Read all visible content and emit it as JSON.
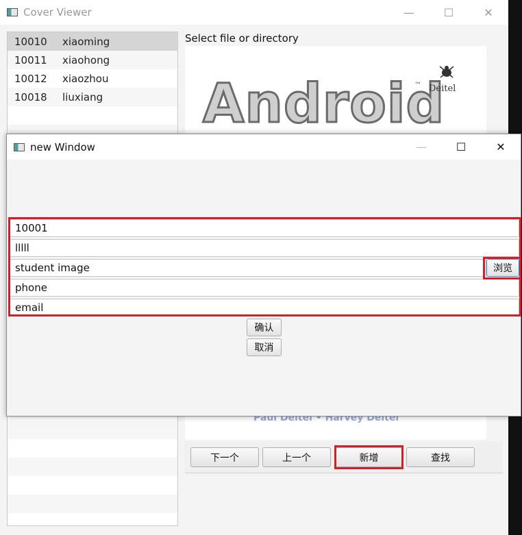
{
  "main_window": {
    "title": "Cover Viewer",
    "min_icon": "—",
    "max_icon": "☐",
    "close_icon": "✕",
    "hint": "Select file or directory",
    "students": [
      {
        "id": "10010",
        "name": "xiaoming"
      },
      {
        "id": "10011",
        "name": "xiaohong"
      },
      {
        "id": "10012",
        "name": "xiaozhou"
      },
      {
        "id": "10018",
        "name": "liuxiang"
      }
    ],
    "cover": {
      "logo_text": "Android",
      "tm": "™",
      "brand": "Deitel",
      "authors": "Paul Deitel • Harvey Deitel"
    },
    "buttons": {
      "next": "下一个",
      "prev": "上一个",
      "add": "新增",
      "find": "查找"
    }
  },
  "dialog": {
    "title": "new Window",
    "min_icon": "—",
    "max_icon": "☐",
    "close_icon": "✕",
    "fields": {
      "id": "10001",
      "name": "lllll",
      "image": "student image",
      "phone": "phone",
      "email": "email"
    },
    "browse": "浏览",
    "confirm": "确认",
    "cancel": "取消"
  },
  "colors": {
    "highlight": "#d0202a",
    "selection": "#d5d5d5"
  }
}
